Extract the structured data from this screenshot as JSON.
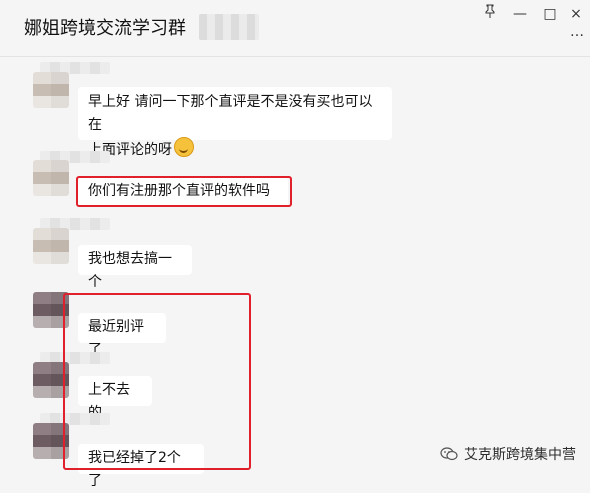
{
  "window": {
    "title": "娜姐跨境交流学习群",
    "pin_icon": "pin-icon",
    "minimize_label": "—",
    "maximize_label": "□",
    "close_label": "×",
    "more_label": "…"
  },
  "messages": [
    {
      "text_line1": "早上好 请问一下那个直评是不是没有买也可以在",
      "text_line2": "上面评论的呀",
      "emoji": "laughing-emoji"
    },
    {
      "text": "你们有注册那个直评的软件吗"
    },
    {
      "text": "我也想去搞一个"
    },
    {
      "text": "最近别评了"
    },
    {
      "text": "上不去的"
    },
    {
      "text": "我已经掉了2个了"
    }
  ],
  "watermark": {
    "text": "艾克斯跨境集中营",
    "icon": "wechat-official-account-icon"
  },
  "colors": {
    "background": "#f5f5f5",
    "bubble": "#ffffff",
    "highlight": "#e0202a"
  }
}
